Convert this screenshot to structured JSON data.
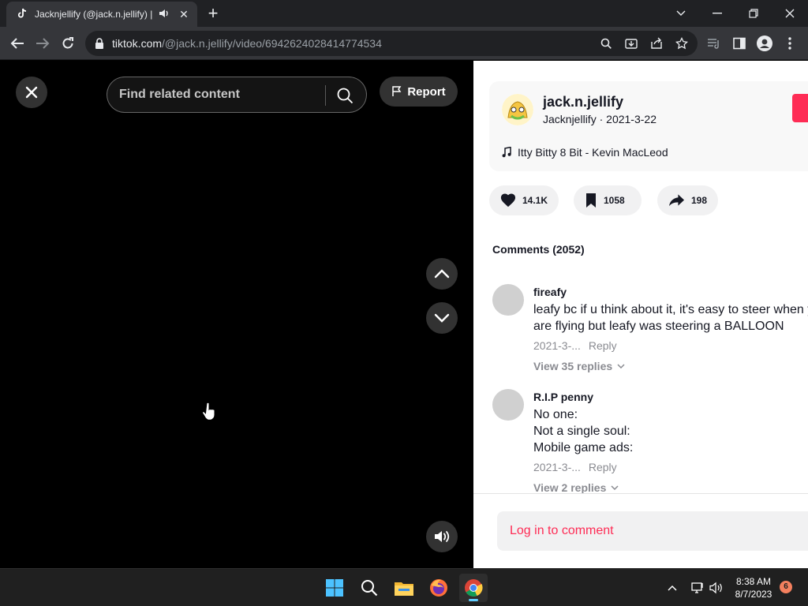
{
  "browser": {
    "tab": {
      "title": "Jacknjellify (@jack.n.jellify) | TikTok",
      "favicon": "tiktok-icon",
      "audio_icon": "speaker-icon",
      "close_icon": "close-icon"
    },
    "new_tab_icon": "plus-icon",
    "window_controls": [
      "chevron-down-icon",
      "minimize-icon",
      "restore-icon",
      "close-icon"
    ],
    "url_host": "tiktok.com",
    "url_path": "/@jack.n.jellify/video/6942624028414774534",
    "toolbar_icons": [
      "back-icon",
      "forward-icon",
      "reload-icon",
      "lock-icon",
      "search-icon",
      "install-icon",
      "share-icon",
      "star-icon",
      "media-icon",
      "sidepanel-icon",
      "profile-icon",
      "menu-icon"
    ]
  },
  "video": {
    "search_placeholder": "Find related content",
    "report_label": "Report"
  },
  "author": {
    "username": "jack.n.jellify",
    "nickname": "Jacknjellify",
    "date": "2021-3-22",
    "music": "Itty Bitty 8 Bit - Kevin MacLeod"
  },
  "actions": {
    "likes": "14.1K",
    "saves": "1058",
    "shares": "198"
  },
  "comments_title": "Comments (2052)",
  "comments": [
    {
      "user": "fireafy",
      "lines": [
        "leafy bc if u think about it, it's easy to steer when you",
        "are flying but leafy was steering a BALLOON"
      ],
      "date": "2021-3-...",
      "reply_label": "Reply",
      "replies_label": "View 35 replies"
    },
    {
      "user": "R.I.P penny",
      "lines": [
        "No one:",
        "Not a single soul:",
        "Mobile game ads:"
      ],
      "date": "2021-3-...",
      "reply_label": "Reply",
      "replies_label": "View 2 replies"
    }
  ],
  "login_label": "Log in to comment",
  "colors": {
    "brand": "#fe2c55",
    "taskbar": "#202020"
  },
  "taskbar": {
    "apps": [
      "windows-start-icon",
      "search-icon",
      "file-explorer-icon",
      "firefox-icon",
      "chrome-icon"
    ],
    "time": "8:38 AM",
    "date": "8/7/2023",
    "notifications": "6"
  }
}
